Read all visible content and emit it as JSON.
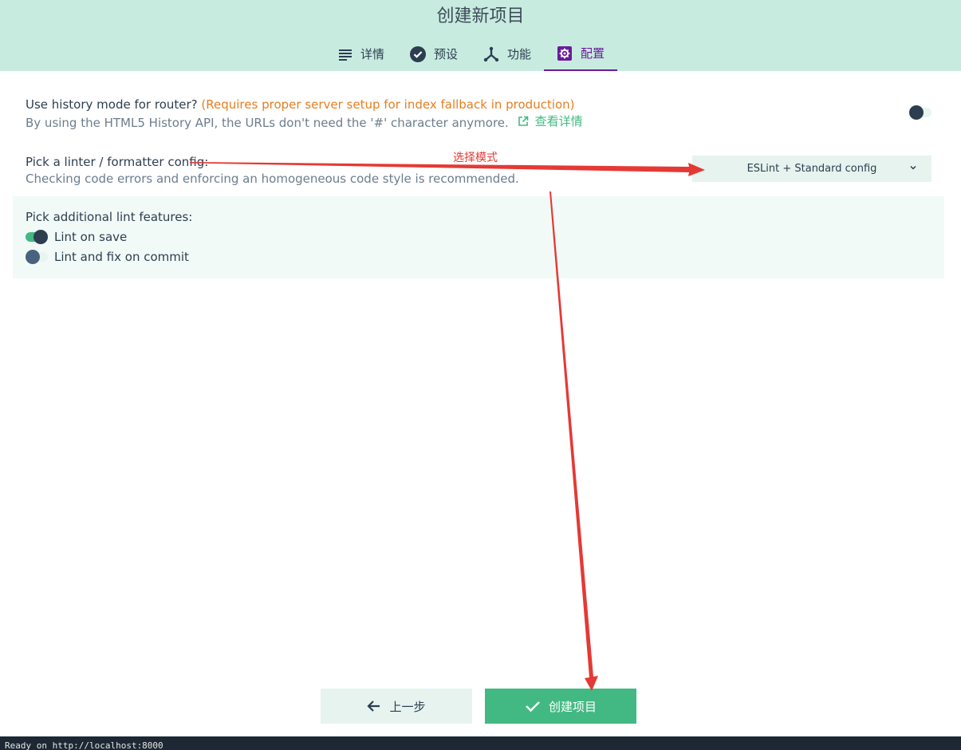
{
  "header": {
    "title": "创建新项目",
    "tabs": [
      {
        "label": "详情",
        "icon": "list-icon",
        "active": false
      },
      {
        "label": "预设",
        "icon": "check-circle-icon",
        "active": false
      },
      {
        "label": "功能",
        "icon": "fork-icon",
        "active": false
      },
      {
        "label": "配置",
        "icon": "settings-icon",
        "active": true
      }
    ]
  },
  "history_mode": {
    "title": "Use history mode for router?",
    "warning": "(Requires proper server setup for index fallback in production)",
    "description": "By using the HTML5 History API, the URLs don't need the '#' character anymore.",
    "more_link": "查看详情",
    "enabled": false
  },
  "linter_config": {
    "title": "Pick a linter / formatter config:",
    "description": "Checking code errors and enforcing an homogeneous code style is recommended.",
    "selected": "ESLint + Standard config"
  },
  "lint_features": {
    "title": "Pick additional lint features:",
    "options": [
      {
        "label": "Lint on save",
        "checked": true
      },
      {
        "label": "Lint and fix on commit",
        "checked": false
      }
    ]
  },
  "footer": {
    "prev_label": "上一步",
    "create_label": "创建项目"
  },
  "statusbar": {
    "text": "Ready on http://localhost:8000"
  },
  "annotation": {
    "label": "选择模式",
    "color": "#e53935"
  },
  "colors": {
    "header_bg": "#c8ebe0",
    "accent": "#42b983",
    "active_tab": "#6a1b9a",
    "warning": "#e67e22"
  }
}
